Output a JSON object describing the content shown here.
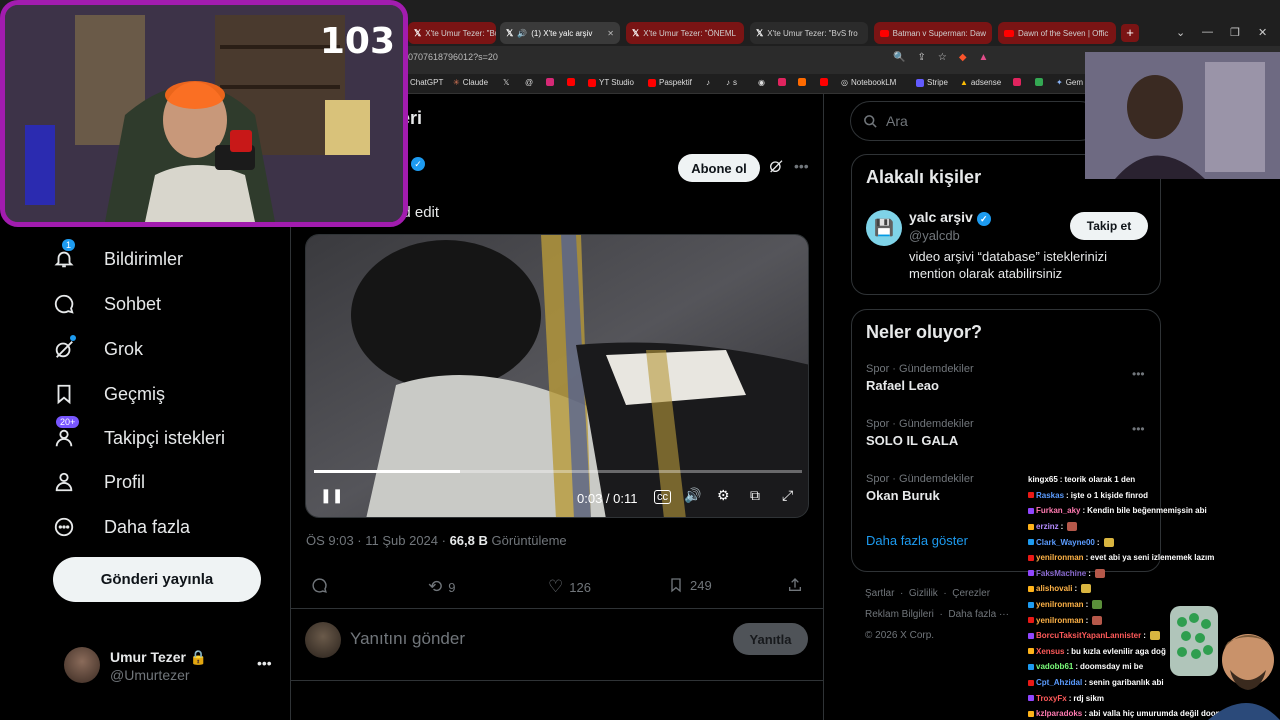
{
  "browser": {
    "tabs": [
      {
        "label": "X'te Umur Tezer: \"Bu h",
        "style": "red",
        "icon": "x"
      },
      {
        "label": "(1) X'te yalc arşiv",
        "style": "active",
        "icon": "x"
      },
      {
        "label": "X'te Umur Tezer: \"ÖNEML",
        "style": "red",
        "icon": "x"
      },
      {
        "label": "X'te Umur Tezer: \"BvS fro",
        "style": "dark",
        "icon": "x"
      },
      {
        "label": "Batman v Superman: Daw",
        "style": "red",
        "icon": "yt"
      },
      {
        "label": "Dawn of the Seven | Offic",
        "style": "red",
        "icon": "yt"
      }
    ],
    "new_tab": "+",
    "url": "07076187960​12?s=20",
    "bookmarks": [
      "ChatGPT",
      "Claude",
      "YT Studio",
      "Paspektif",
      "s",
      "NotebookLM",
      "Stripe",
      "adsense",
      "Gem"
    ]
  },
  "stream": {
    "viewer_count": "103"
  },
  "nav": {
    "items": [
      {
        "label": "Bildirimler",
        "badge": "1",
        "icon": "bell-icon"
      },
      {
        "label": "Sohbet",
        "badge": "",
        "icon": "chat-icon"
      },
      {
        "label": "Grok",
        "badge": "",
        "icon": "grok-icon"
      },
      {
        "label": "Geçmiş",
        "badge": "",
        "icon": "bookmark-icon"
      },
      {
        "label": "Takipçi istekleri",
        "badge": "20+",
        "icon": "follow-requests-icon"
      },
      {
        "label": "Profil",
        "badge": "",
        "icon": "profile-icon"
      },
      {
        "label": "Daha fazla",
        "badge": "",
        "icon": "more-circle-icon"
      }
    ],
    "post_button": "Gönderi yayınla",
    "account": {
      "name": "Umur Tezer",
      "handle": "@Umurtezer"
    }
  },
  "tweet": {
    "header_fragment": "eri",
    "follow_button": "Abone ol",
    "text_fragment": "ad edit",
    "video": {
      "time": "0:03 / 0:11",
      "progress": 0.3
    },
    "timestamp": "ÖS 9:03 · 11 Şub 2024 · ",
    "views_value": "66,8 B",
    "views_label": " Görüntüleme",
    "retweets": "9",
    "likes": "126",
    "bookmarks": "249",
    "reply_placeholder": "Yanıtını gönder",
    "reply_button": "Yanıtla"
  },
  "right": {
    "search_placeholder": "Ara",
    "related": {
      "title": "Alakalı kişiler",
      "name": "yalc arşiv",
      "handle": "@yalcdb",
      "bio": "video arşivi “database” isteklerinizi mention olarak atabilirsiniz",
      "button": "Takip et"
    },
    "trends": {
      "title": "Neler oluyor?",
      "items": [
        {
          "category": "Spor · Gündemdekiler",
          "topic": "Rafael Leao"
        },
        {
          "category": "Spor · Gündemdekiler",
          "topic": "SOLO IL GALA"
        },
        {
          "category": "Spor · Gündemdekiler",
          "topic": "Okan Buruk"
        }
      ],
      "show_more": "Daha fazla göster"
    },
    "footer": [
      "Şartlar",
      "Gizlilik",
      "Çerezler",
      "Reklam Bilgileri",
      "Daha fazla",
      "© 2026 X Corp."
    ]
  },
  "chat": [
    {
      "user": "kingx65",
      "color": "#ffffff",
      "msg": "teorik olarak 1 den"
    },
    {
      "user": "Raskas",
      "color": "#5b9cff",
      "msg": "işte o 1 kişide finrod"
    },
    {
      "user": "Furkan_aky",
      "color": "#ff7ab0",
      "msg": "Kendin bile beğenmemişsin abi"
    },
    {
      "user": "erzinz",
      "color": "#b58cff",
      "msg": ""
    },
    {
      "user": "Clark_Wayne00",
      "color": "#5b9cff",
      "msg": ""
    },
    {
      "user": "yenilronman",
      "color": "#ffb347",
      "msg": "evet abi ya seni izlememek lazım"
    },
    {
      "user": "FaksMachine",
      "color": "#8a6ad0",
      "msg": ""
    },
    {
      "user": "alishovali",
      "color": "#ffb347",
      "msg": ""
    },
    {
      "user": "yenilronman",
      "color": "#ffb347",
      "msg": ""
    },
    {
      "user": "yenilronman",
      "color": "#ffb347",
      "msg": ""
    },
    {
      "user": "BorcuTaksitYapanLannister",
      "color": "#ff5a5a",
      "msg": ""
    },
    {
      "user": "Xensus",
      "color": "#ff5a5a",
      "msg": "bu kızla evlenilir aga doğ"
    },
    {
      "user": "vadobb61",
      "color": "#7cff7c",
      "msg": "doomsday mi be"
    },
    {
      "user": "Cpt_Ahzidal",
      "color": "#5b9cff",
      "msg": "senin garibanlık abi"
    },
    {
      "user": "TroxyFx",
      "color": "#ff5a5a",
      "msg": "rdj sikm"
    },
    {
      "user": "kzlparadoks",
      "color": "#ff7ab0",
      "msg": "abi valla hiç umurumda değil doomsday"
    }
  ]
}
